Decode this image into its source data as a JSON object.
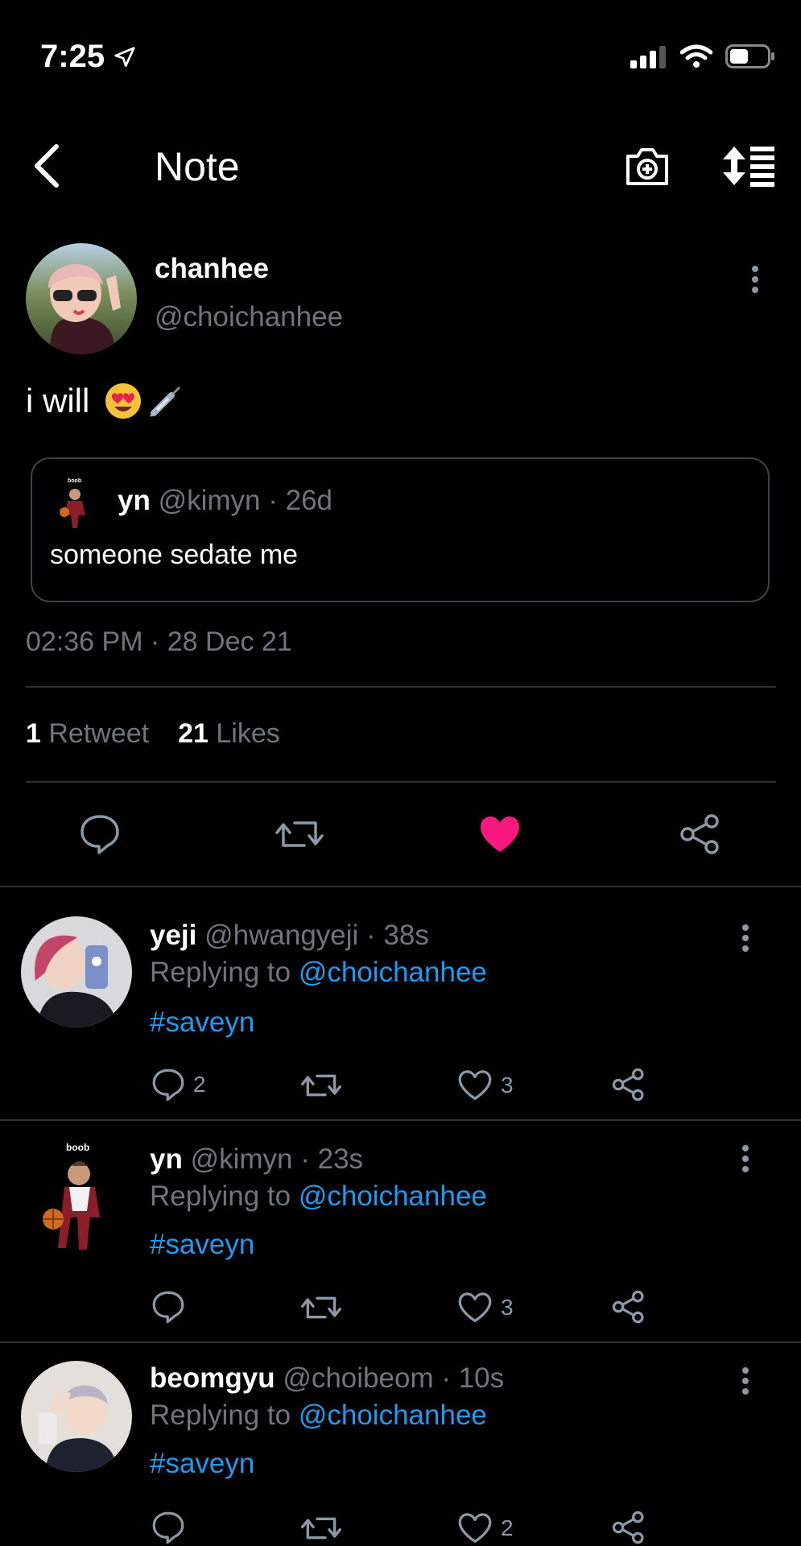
{
  "status_bar": {
    "time": "7:25"
  },
  "nav": {
    "title": "Note"
  },
  "tweet": {
    "name": "chanhee",
    "handle": "@choichanhee",
    "text": "i will",
    "emojis": [
      "heart-eyes-emoji",
      "syringe-emoji"
    ],
    "quote": {
      "name": "yn",
      "meta": "@kimyn · 26d",
      "text": "someone sedate me",
      "avatar_caption": "boob"
    },
    "timestamp": "02:36 PM · 28 Dec 21",
    "retweet_count": "1",
    "retweet_label": "Retweet",
    "like_count": "21",
    "like_label": "Likes",
    "liked": true
  },
  "replies": [
    {
      "name": "yeji",
      "meta": "@hwangyeji · 38s",
      "replying_prefix": "Replying to",
      "replying_to": "@choichanhee",
      "text": "#saveyn",
      "reply_count": "2",
      "like_count": "3"
    },
    {
      "name": "yn",
      "meta": "@kimyn · 23s",
      "replying_prefix": "Replying to",
      "replying_to": "@choichanhee",
      "text": "#saveyn",
      "reply_count": "",
      "like_count": "3",
      "avatar_caption": "boob"
    },
    {
      "name": "beomgyu",
      "meta": "@choibeom · 10s",
      "replying_prefix": "Replying to",
      "replying_to": "@choichanhee",
      "text": "#saveyn",
      "reply_count": "",
      "like_count": "2"
    }
  ],
  "colors": {
    "background": "#000000",
    "muted": "#6e767d",
    "link": "#1d9bf0",
    "like": "#f91880",
    "divider": "#2f3336"
  }
}
